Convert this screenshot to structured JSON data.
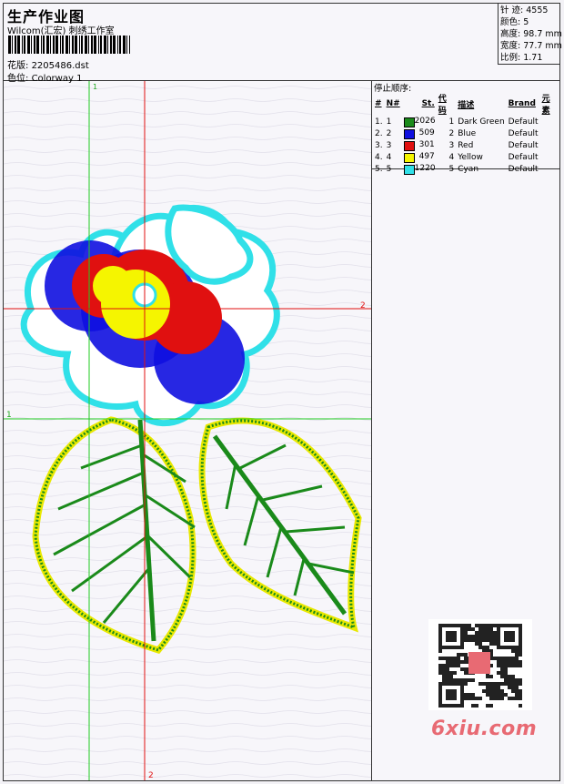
{
  "header": {
    "title": "生产作业图",
    "studio": "Wilcom(汇宏) 刺绣工作室",
    "design_label": "花版:",
    "design_value": "2205486.dst",
    "colorway_label": "色位:",
    "colorway_value": "Colorway 1"
  },
  "stats": {
    "stitches_label": "针 迹:",
    "stitches_value": "4555",
    "colors_label": "颜色:",
    "colors_value": "5",
    "height_label": "高度:",
    "height_value": "98.7 mm",
    "width_label": "宽度:",
    "width_value": "77.7 mm",
    "ratio_label": "比例:",
    "ratio_value": "1.71"
  },
  "stops": {
    "title": "停止顺序:",
    "headers": [
      "#",
      "N#",
      "St.",
      "代码",
      "描述",
      "Brand",
      "元素"
    ],
    "rows": [
      {
        "idx": "1.",
        "n": "1",
        "color": "#1a8a1a",
        "st": "2026",
        "code": "1",
        "desc": "Dark Green",
        "brand": "Default"
      },
      {
        "idx": "2.",
        "n": "2",
        "color": "#1010e0",
        "st": "509",
        "code": "2",
        "desc": "Blue",
        "brand": "Default"
      },
      {
        "idx": "3.",
        "n": "3",
        "color": "#e01010",
        "st": "301",
        "code": "3",
        "desc": "Red",
        "brand": "Default"
      },
      {
        "idx": "4.",
        "n": "4",
        "color": "#f5f500",
        "st": "497",
        "code": "4",
        "desc": "Yellow",
        "brand": "Default"
      },
      {
        "idx": "5.",
        "n": "5",
        "color": "#30e0e8",
        "st": "1220",
        "code": "5",
        "desc": "Cyan",
        "brand": "Default"
      }
    ]
  },
  "guides": {
    "v1_label": "1",
    "v2_label": "2",
    "h1_label": "1",
    "h2_label": "2",
    "green": "#22cc22",
    "red": "#e01010"
  },
  "watermark": {
    "site": "6xiu.com",
    "color": "#e86a73"
  }
}
